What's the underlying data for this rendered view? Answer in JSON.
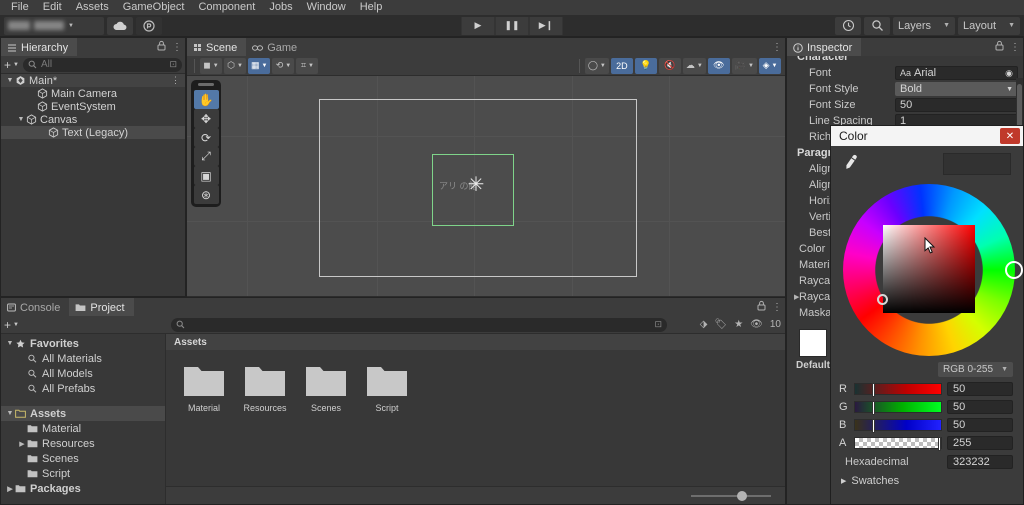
{
  "menu": {
    "items": [
      "File",
      "Edit",
      "Assets",
      "GameObject",
      "Component",
      "Jobs",
      "Window",
      "Help"
    ]
  },
  "toolbar": {
    "cloud_icon": "cloud-icon",
    "collab_icon": "collab-icon",
    "play_label": "▶",
    "pause_label": "❚❚",
    "step_label": "▶❙",
    "undo_icon": "undo-history-icon",
    "search_icon": "search-icon",
    "layers_label": "Layers",
    "layout_label": "Layout",
    "caret": "▼"
  },
  "hierarchy": {
    "tab": "Hierarchy",
    "lock_icon": "lock-icon",
    "menu_icon": "kebab-menu-icon",
    "add_label": "+",
    "search_placeholder": "All",
    "search_icon": "search-icon",
    "items": [
      {
        "label": "Main*",
        "depth": 0,
        "expanded": true,
        "icon": "unity-scene-icon",
        "selected": false,
        "kebab": "⋮"
      },
      {
        "label": "Main Camera",
        "depth": 2,
        "expanded": null,
        "icon": "gameobject-icon",
        "selected": false
      },
      {
        "label": "EventSystem",
        "depth": 2,
        "expanded": null,
        "icon": "gameobject-icon",
        "selected": false
      },
      {
        "label": "Canvas",
        "depth": 1,
        "expanded": true,
        "icon": "gameobject-icon",
        "selected": false
      },
      {
        "label": "Text (Legacy)",
        "depth": 3,
        "expanded": null,
        "icon": "gameobject-icon",
        "selected": true
      }
    ]
  },
  "scene": {
    "tabs": [
      {
        "label": "Scene",
        "icon": "scene-grid-icon",
        "active": true
      },
      {
        "label": "Game",
        "icon": "gamepad-icon",
        "active": false
      }
    ],
    "menu_icon": "kebab-menu-icon",
    "toolbar_left": [
      {
        "name": "draw-mode-dropdown",
        "glyph": "◼",
        "caret": "▼",
        "on": false
      },
      {
        "name": "shading-mode-dropdown",
        "glyph": "⬡",
        "caret": "▼",
        "on": false
      },
      {
        "name": "toggle-2d-grid",
        "glyph": "▦",
        "caret": "▼",
        "on": true
      },
      {
        "name": "snap-increment-dropdown",
        "glyph": "⟲",
        "caret": "▼",
        "on": false
      },
      {
        "name": "grid-snapping-dropdown",
        "glyph": "⌗",
        "caret": "▼",
        "on": false
      }
    ],
    "toolbar_right": [
      {
        "name": "scene-view-camera-mode",
        "glyph": "◯",
        "caret": "▼",
        "on": false
      },
      {
        "name": "toggle-2d-view",
        "glyph": "2D",
        "caret": "",
        "on": true
      },
      {
        "name": "toggle-scene-lighting",
        "glyph": "💡",
        "caret": "",
        "on": true
      },
      {
        "name": "toggle-audio",
        "glyph": "🔇",
        "caret": "",
        "on": false
      },
      {
        "name": "toggle-fx",
        "glyph": "☁",
        "caret": "▼",
        "on": false
      },
      {
        "name": "toggle-hidden-objects",
        "glyph": "👁",
        "caret": "",
        "on": true
      },
      {
        "name": "scene-camera-settings",
        "glyph": "🎥",
        "caret": "▼",
        "on": false
      },
      {
        "name": "gizmos-toggle",
        "glyph": "◈",
        "caret": "▼",
        "on": true
      }
    ],
    "tools": [
      {
        "name": "hand-tool",
        "glyph": "✋",
        "active": true
      },
      {
        "name": "move-tool",
        "glyph": "✥",
        "active": false
      },
      {
        "name": "rotate-tool",
        "glyph": "⟳",
        "active": false
      },
      {
        "name": "scale-tool",
        "glyph": "⤢",
        "active": false
      },
      {
        "name": "rect-transform-tool",
        "glyph": "▣",
        "active": false
      },
      {
        "name": "transform-tool",
        "glyph": "⊛",
        "active": false
      }
    ],
    "object_text": "アリ     の館",
    "pivot_glyph": "✳"
  },
  "project": {
    "tabs": [
      {
        "label": "Project",
        "icon": "folder-icon",
        "active": true
      },
      {
        "label": "Console",
        "icon": "console-icon",
        "active": false
      }
    ],
    "lock_icon": "lock-icon",
    "menu_icon": "kebab-menu-icon",
    "add_label": "+",
    "search_placeholder": "",
    "search_icon": "search-icon",
    "filter_icons": [
      "asset-type-filter-icon",
      "label-filter-icon",
      "favorites-filter-icon",
      "hidden-packages-icon"
    ],
    "hidden_packages_count": "10",
    "tree": [
      {
        "label": "Favorites",
        "depth": 0,
        "tri": "▼",
        "icon": "star-icon",
        "bold": true,
        "selected": false
      },
      {
        "label": "All Materials",
        "depth": 1,
        "tri": "",
        "icon": "search-icon",
        "bold": false,
        "selected": false
      },
      {
        "label": "All Models",
        "depth": 1,
        "tri": "",
        "icon": "search-icon",
        "bold": false,
        "selected": false
      },
      {
        "label": "All Prefabs",
        "depth": 1,
        "tri": "",
        "icon": "search-icon",
        "bold": false,
        "selected": false
      },
      {
        "label": "",
        "depth": 0,
        "tri": "",
        "icon": "",
        "bold": false,
        "selected": false
      },
      {
        "label": "Assets",
        "depth": 0,
        "tri": "▼",
        "icon": "folder-open-icon",
        "bold": true,
        "selected": true
      },
      {
        "label": "Material",
        "depth": 1,
        "tri": "",
        "icon": "folder-icon",
        "bold": false,
        "selected": false
      },
      {
        "label": "Resources",
        "depth": 1,
        "tri": "▶",
        "icon": "folder-icon",
        "bold": false,
        "selected": false
      },
      {
        "label": "Scenes",
        "depth": 1,
        "tri": "",
        "icon": "folder-icon",
        "bold": false,
        "selected": false
      },
      {
        "label": "Script",
        "depth": 1,
        "tri": "",
        "icon": "folder-icon",
        "bold": false,
        "selected": false
      },
      {
        "label": "Packages",
        "depth": 0,
        "tri": "▶",
        "icon": "folder-icon",
        "bold": true,
        "selected": false
      }
    ],
    "breadcrumb": "Assets",
    "assets": [
      {
        "label": "Material",
        "icon": "folder-icon"
      },
      {
        "label": "Resources",
        "icon": "folder-icon"
      },
      {
        "label": "Scenes",
        "icon": "folder-icon"
      },
      {
        "label": "Script",
        "icon": "folder-icon"
      }
    ],
    "zoom_icon": "zoom-slider"
  },
  "inspector": {
    "tab": "Inspector",
    "info_icon": "info-icon",
    "lock_icon": "lock-icon",
    "menu_icon": "kebab-menu-icon",
    "character_section": "Character",
    "rows": [
      {
        "label": "Font",
        "value": "Arial",
        "type": "object",
        "icon": "font-icon",
        "picker": "target-icon"
      },
      {
        "label": "Font Style",
        "value": "Bold",
        "type": "enum",
        "caret": "▼"
      },
      {
        "label": "Font Size",
        "value": "50",
        "type": "text"
      },
      {
        "label": "Line Spacing",
        "value": "1",
        "type": "text"
      },
      {
        "label": "Rich Text",
        "value": "",
        "type": "toggle"
      }
    ],
    "paragraph_section": "Paragraph",
    "paragraph_rows": [
      {
        "label": "Alignment"
      },
      {
        "label": "Align By Geometry"
      },
      {
        "label": "Horizontal Overflow"
      },
      {
        "label": "Vertical Overflow"
      },
      {
        "label": "Best Fit"
      }
    ],
    "tail_rows": [
      {
        "label": "Color",
        "tri": ""
      },
      {
        "label": "Material",
        "tri": ""
      },
      {
        "label": "Raycast Target",
        "tri": ""
      },
      {
        "label": "Raycast Padding",
        "tri": "▶"
      },
      {
        "label": "Maskable",
        "tri": ""
      }
    ],
    "material_swatch_label": "Default"
  },
  "color_picker": {
    "title": "Color",
    "close_label": "✕",
    "eyedropper_icon": "eyedropper-icon",
    "preview_color": "#323232",
    "mode_label": "RGB 0-255",
    "mode_caret": "▼",
    "channels": [
      {
        "name": "R",
        "value": "50",
        "knob_pct": 20
      },
      {
        "name": "G",
        "value": "50",
        "knob_pct": 20
      },
      {
        "name": "B",
        "value": "50",
        "knob_pct": 20
      },
      {
        "name": "A",
        "value": "255",
        "knob_pct": 96
      }
    ],
    "hex_label": "Hexadecimal",
    "hex_value": "323232",
    "swatches_label": "Swatches",
    "swatches_tri": "▶"
  }
}
